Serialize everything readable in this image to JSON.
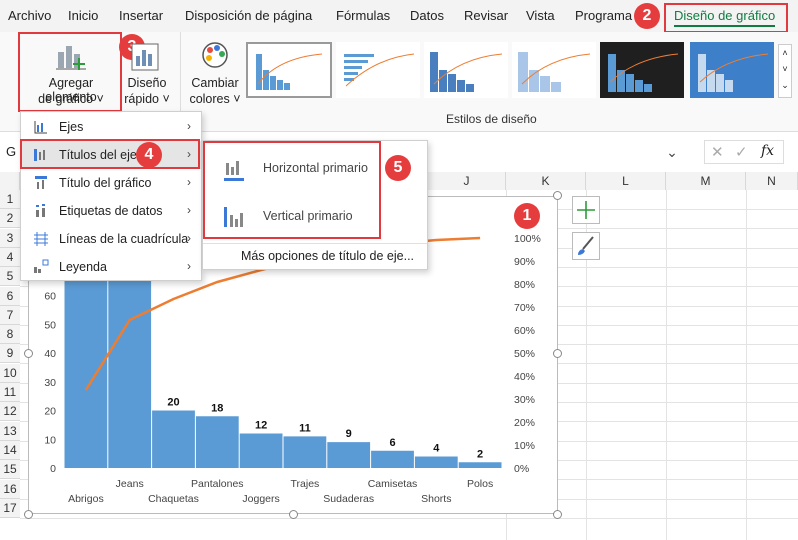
{
  "menu": {
    "items": [
      "Archivo",
      "Inicio",
      "Insertar",
      "Disposición de página",
      "Fórmulas",
      "Datos",
      "Revisar",
      "Vista",
      "Programa",
      "Diseño de gráfico"
    ]
  },
  "ribbon": {
    "add_element_line1": "Agregar elemento",
    "add_element_line2": "de gráfico",
    "quick_layout_line1": "Diseño",
    "quick_layout_line2": "rápido",
    "change_colors_line1": "Cambiar",
    "change_colors_line2": "colores",
    "styles_group_label": "Estilos de diseño"
  },
  "formula_bar": {
    "name_box": "G",
    "fx": "fx"
  },
  "columns": [
    "J",
    "K",
    "L",
    "M",
    "N"
  ],
  "rows": [
    "1",
    "2",
    "3",
    "4",
    "5",
    "6",
    "7",
    "8",
    "9",
    "10",
    "11",
    "12",
    "13",
    "14",
    "15",
    "16",
    "17"
  ],
  "dropdown": {
    "items": [
      {
        "label": "Ejes"
      },
      {
        "label": "Títulos del eje"
      },
      {
        "label": "Título del gráfico"
      },
      {
        "label": "Etiquetas de datos"
      },
      {
        "label": "Líneas de la cuadrícula"
      },
      {
        "label": "Leyenda"
      }
    ]
  },
  "submenu": {
    "horizontal": "Horizontal primario",
    "vertical": "Vertical primario",
    "more": "Más opciones de título de eje..."
  },
  "badges": [
    "1",
    "2",
    "3",
    "4",
    "5"
  ],
  "chart_data": {
    "type": "bar",
    "categories": [
      "Abrigos",
      "Jeans",
      "Chaquetas",
      "Pantalones",
      "Joggers",
      "Trajes",
      "Sudaderas",
      "Camisetas",
      "Shorts",
      "Polos"
    ],
    "values": [
      null,
      null,
      20,
      18,
      12,
      11,
      9,
      6,
      4,
      2
    ],
    "left_ticks": [
      "0",
      "10",
      "20",
      "30",
      "40",
      "50",
      "60"
    ],
    "right_ticks": [
      "0%",
      "10%",
      "20%",
      "30%",
      "40%",
      "50%",
      "60%",
      "70%",
      "80%",
      "90%",
      "100%"
    ],
    "data_labels": [
      "20",
      "18",
      "12",
      "11",
      "9",
      "6",
      "4",
      "2"
    ],
    "bar_color": "#5b9bd5",
    "line_color": "#ed7d31"
  },
  "colors": {
    "accent_green": "#107c41",
    "badge_red": "#e53d3d"
  }
}
